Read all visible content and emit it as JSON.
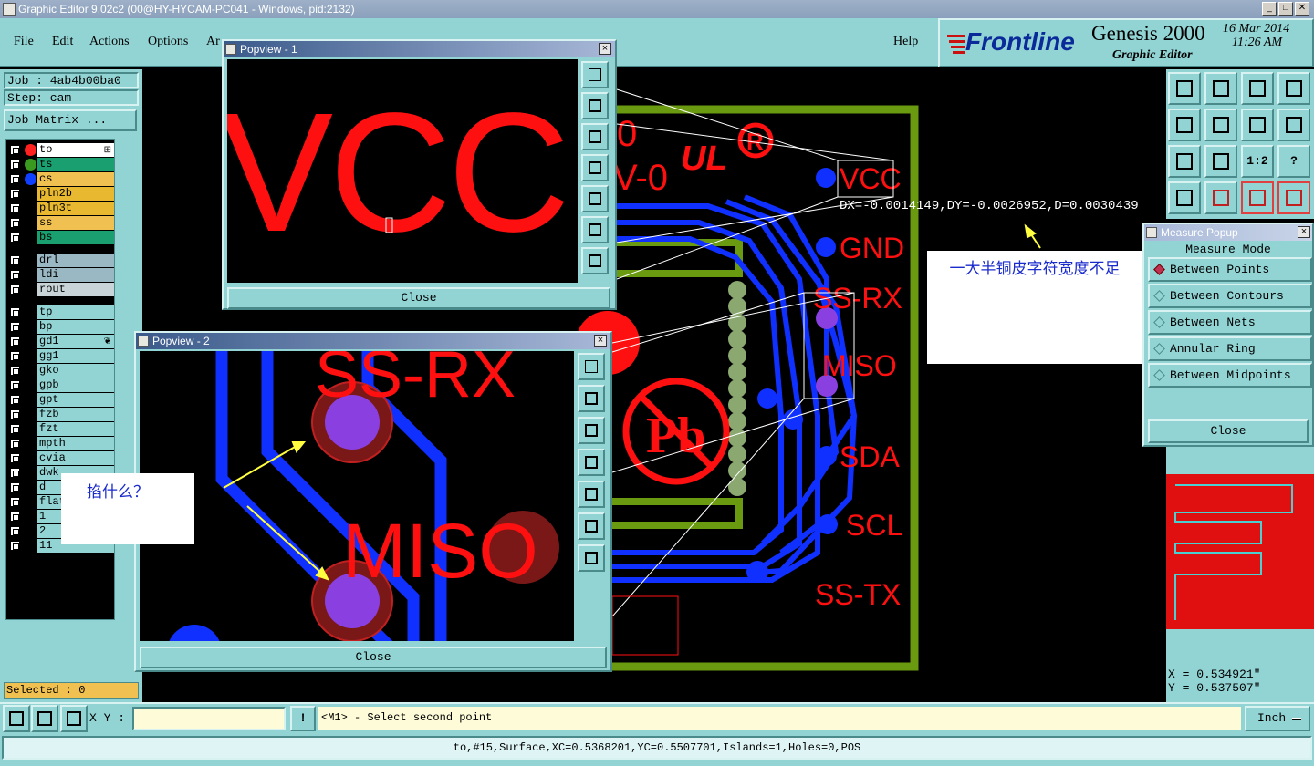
{
  "window": {
    "title": "Graphic Editor 9.02c2 (00@HY-HYCAM-PC041 - Windows, pid:2132)",
    "min_label": "_",
    "max_label": "□",
    "close_label": "✕"
  },
  "menu": {
    "items": [
      "File",
      "Edit",
      "Actions",
      "Options",
      "Ar"
    ],
    "help": "Help"
  },
  "brand": {
    "logo": "Frontline",
    "product": "Genesis 2000",
    "subtitle": "Graphic Editor",
    "date": "16 Mar 2014",
    "time": "11:26 AM",
    "accent": "#cc1010"
  },
  "left_panel": {
    "job": "Job : 4ab4b00ba0",
    "step": "Step: cam",
    "job_matrix": "Job Matrix ...",
    "selected": "Selected : 0"
  },
  "layers": [
    {
      "name": "to",
      "bg": "#ffffff",
      "dot": "#ff2020",
      "mark": "⊞"
    },
    {
      "name": "ts",
      "bg": "#1aa070",
      "dot": "#3a9a20"
    },
    {
      "name": "cs",
      "bg": "#f0c050",
      "dot": "#1040ff"
    },
    {
      "name": "pln2b",
      "bg": "#e8b830"
    },
    {
      "name": "pln3t",
      "bg": "#e8b830"
    },
    {
      "name": "ss",
      "bg": "#f0c050"
    },
    {
      "name": "bs",
      "bg": "#1aa070"
    },
    {
      "name": "drl",
      "bg": "#9ab8c4"
    },
    {
      "name": "ldi",
      "bg": "#9ab8c4"
    },
    {
      "name": "rout",
      "bg": "#c8d4d8"
    },
    {
      "name": "tp",
      "bg": "#92d3d3"
    },
    {
      "name": "bp",
      "bg": "#92d3d3"
    },
    {
      "name": "gd1",
      "bg": "#92d3d3",
      "mark": "❦"
    },
    {
      "name": "gg1",
      "bg": "#92d3d3"
    },
    {
      "name": "gko",
      "bg": "#92d3d3"
    },
    {
      "name": "gpb",
      "bg": "#92d3d3"
    },
    {
      "name": "gpt",
      "bg": "#92d3d3"
    },
    {
      "name": "fzb",
      "bg": "#92d3d3"
    },
    {
      "name": "fzt",
      "bg": "#92d3d3"
    },
    {
      "name": "mpth",
      "bg": "#92d3d3"
    },
    {
      "name": "cvia",
      "bg": "#92d3d3"
    },
    {
      "name": "dwk",
      "bg": "#92d3d3"
    },
    {
      "name": "d",
      "bg": "#92d3d3"
    },
    {
      "name": "flat",
      "bg": "#92d3d3"
    },
    {
      "name": "1",
      "bg": "#92d3d3"
    },
    {
      "name": "2",
      "bg": "#92d3d3"
    },
    {
      "name": "11",
      "bg": "#92d3d3"
    }
  ],
  "canvas": {
    "labels": {
      "vcc": "VCC",
      "gnd": "GND",
      "ssrx": "SS-RX",
      "miso": "MISO",
      "sda": "SDA",
      "scl": "SCL",
      "sstx": "SS-TX",
      "v0": "V-0",
      "zero": "0",
      "ul": "UL",
      "reg": "R",
      "pb": "Pb"
    },
    "measure_readout": "DX=-0.0014149,DY=-0.0026952,D=0.0030439",
    "colors": {
      "pad": "#ff1010",
      "trace": "#1030ff",
      "outline": "#6a9a10",
      "via": "#8a40e0"
    }
  },
  "popview1": {
    "title": "Popview - 1",
    "text": "VCC",
    "close": "Close"
  },
  "popview2": {
    "title": "Popview - 2",
    "text_a": "SS-RX",
    "text_b": "MISO",
    "close": "Close"
  },
  "notes": {
    "right": "一大半铜皮字符宽度不足",
    "left": "掐什么？"
  },
  "measure_popup": {
    "title": "Measure Popup",
    "mode": "Measure Mode",
    "options": [
      "Between Points",
      "Between Contours",
      "Between Nets",
      "Annular Ring",
      "Between Midpoints"
    ],
    "selected": 0,
    "close": "Close"
  },
  "toolbar_text": {
    "ratio": "1:2",
    "help": "?"
  },
  "coords": {
    "x": "X = 0.534921\"",
    "y": "Y = 0.537507\""
  },
  "bottom": {
    "xy_label": "X Y :",
    "xy_value": "",
    "bang": "!",
    "prompt": "<M1> - Select second point",
    "units": "Inch"
  },
  "status": "to,#15,Surface,XC=0.5368201,YC=0.5507701,Islands=1,Holes=0,POS"
}
